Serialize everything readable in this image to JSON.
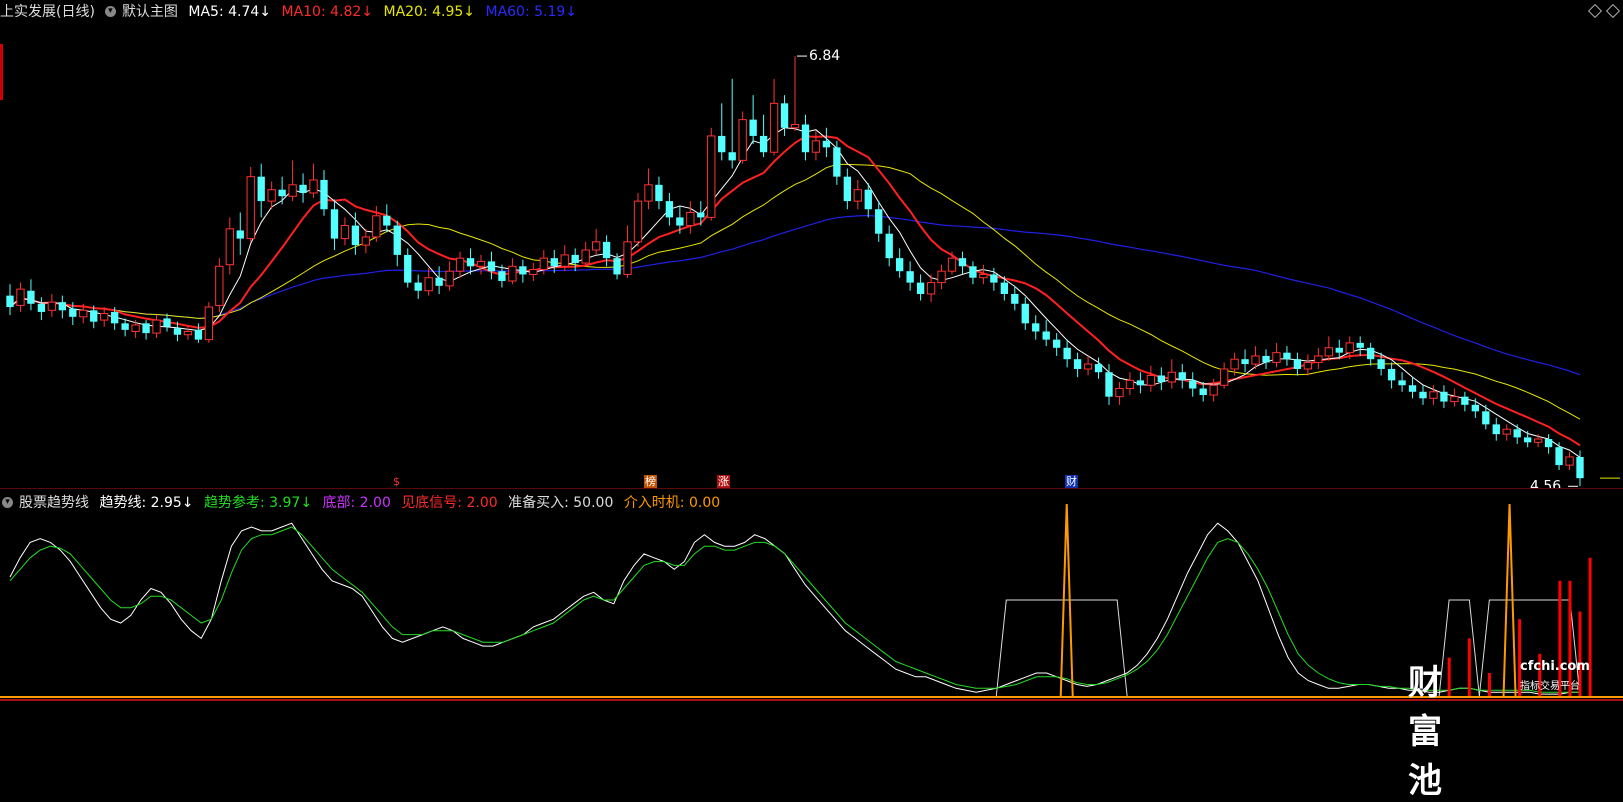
{
  "main_header": {
    "title": "上实发展(日线)",
    "template": "默认主图",
    "ma5": "MA5: 4.74↓",
    "ma10": "MA10: 4.82↓",
    "ma20": "MA20: 4.95↓",
    "ma60": "MA60: 5.19↓"
  },
  "sub_header": {
    "title": "股票趋势线",
    "trend": "趋势线: 2.95↓",
    "trend_ref": "趋势参考: 3.97↓",
    "bottom": "底部: 2.00",
    "bottom_signal": "见底信号: 2.00",
    "prepare_buy": "准备买入: 50.00",
    "entry_timing": "介入时机: 0.00"
  },
  "markers": {
    "s": "$",
    "bang": "榜",
    "zhang": "涨",
    "cai": "财"
  },
  "watermark": {
    "brand": "财富池",
    "url": "cfchi.com",
    "tagline": "指标交易平台"
  },
  "colors": {
    "up": "#ff3232",
    "down": "#54ffff",
    "ma5": "#ffffff",
    "ma10": "#ff2020",
    "ma20": "#e6e600",
    "ma60": "#2020e6",
    "trend": "#ffffff",
    "trend_ref": "#22dd22",
    "signal": "#ff9900",
    "bottom": "#ff0000"
  },
  "chart_data": [
    {
      "type": "candlestick",
      "title": "上实发展(日线)",
      "ylim": [
        4.3,
        7.0
      ],
      "annotations": [
        {
          "label": "6.84",
          "type": "high"
        },
        {
          "label": "4.56",
          "type": "low"
        }
      ],
      "candles": [
        [
          5.37,
          5.3,
          5.44,
          5.25
        ],
        [
          5.31,
          5.41,
          5.45,
          5.27
        ],
        [
          5.4,
          5.32,
          5.47,
          5.28
        ],
        [
          5.32,
          5.27,
          5.36,
          5.22
        ],
        [
          5.28,
          5.33,
          5.38,
          5.24
        ],
        [
          5.33,
          5.28,
          5.37,
          5.23
        ],
        [
          5.29,
          5.24,
          5.33,
          5.19
        ],
        [
          5.24,
          5.28,
          5.32,
          5.2
        ],
        [
          5.28,
          5.21,
          5.31,
          5.17
        ],
        [
          5.22,
          5.26,
          5.3,
          5.18
        ],
        [
          5.27,
          5.2,
          5.3,
          5.16
        ],
        [
          5.2,
          5.16,
          5.23,
          5.12
        ],
        [
          5.15,
          5.19,
          5.22,
          5.11
        ],
        [
          5.2,
          5.14,
          5.22,
          5.1
        ],
        [
          5.14,
          5.22,
          5.25,
          5.11
        ],
        [
          5.23,
          5.18,
          5.26,
          5.15
        ],
        [
          5.17,
          5.13,
          5.21,
          5.09
        ],
        [
          5.13,
          5.15,
          5.18,
          5.1
        ],
        [
          5.16,
          5.1,
          5.2,
          5.08
        ],
        [
          5.1,
          5.3,
          5.33,
          5.08
        ],
        [
          5.31,
          5.55,
          5.6,
          5.27
        ],
        [
          5.56,
          5.78,
          5.85,
          5.5
        ],
        [
          5.77,
          5.72,
          5.88,
          5.62
        ],
        [
          5.72,
          6.1,
          6.16,
          5.7
        ],
        [
          6.1,
          5.95,
          6.18,
          5.85
        ],
        [
          5.95,
          6.02,
          6.07,
          5.9
        ],
        [
          6.02,
          5.98,
          6.1,
          5.93
        ],
        [
          5.98,
          6.05,
          6.2,
          5.95
        ],
        [
          6.05,
          6.0,
          6.12,
          5.94
        ],
        [
          6.0,
          6.08,
          6.18,
          5.97
        ],
        [
          6.08,
          5.9,
          6.14,
          5.86
        ],
        [
          5.9,
          5.72,
          5.96,
          5.65
        ],
        [
          5.72,
          5.8,
          5.85,
          5.68
        ],
        [
          5.8,
          5.68,
          5.88,
          5.62
        ],
        [
          5.68,
          5.73,
          5.78,
          5.63
        ],
        [
          5.73,
          5.86,
          5.92,
          5.7
        ],
        [
          5.86,
          5.8,
          5.93,
          5.76
        ],
        [
          5.8,
          5.62,
          5.83,
          5.55
        ],
        [
          5.62,
          5.45,
          5.66,
          5.42
        ],
        [
          5.45,
          5.4,
          5.5,
          5.35
        ],
        [
          5.4,
          5.48,
          5.54,
          5.37
        ],
        [
          5.48,
          5.43,
          5.55,
          5.38
        ],
        [
          5.43,
          5.52,
          5.58,
          5.4
        ],
        [
          5.52,
          5.6,
          5.64,
          5.48
        ],
        [
          5.6,
          5.55,
          5.66,
          5.5
        ],
        [
          5.55,
          5.58,
          5.62,
          5.5
        ],
        [
          5.58,
          5.52,
          5.64,
          5.47
        ],
        [
          5.52,
          5.46,
          5.56,
          5.42
        ],
        [
          5.46,
          5.55,
          5.6,
          5.44
        ],
        [
          5.55,
          5.5,
          5.59,
          5.45
        ],
        [
          5.5,
          5.53,
          5.57,
          5.46
        ],
        [
          5.53,
          5.6,
          5.65,
          5.5
        ],
        [
          5.6,
          5.55,
          5.65,
          5.51
        ],
        [
          5.55,
          5.62,
          5.68,
          5.52
        ],
        [
          5.62,
          5.57,
          5.66,
          5.52
        ],
        [
          5.57,
          5.65,
          5.7,
          5.55
        ],
        [
          5.65,
          5.7,
          5.78,
          5.62
        ],
        [
          5.7,
          5.6,
          5.74,
          5.55
        ],
        [
          5.6,
          5.5,
          5.63,
          5.47
        ],
        [
          5.5,
          5.7,
          5.8,
          5.48
        ],
        [
          5.7,
          5.95,
          6.0,
          5.67
        ],
        [
          5.95,
          6.05,
          6.15,
          5.9
        ],
        [
          6.05,
          5.95,
          6.1,
          5.9
        ],
        [
          5.95,
          5.85,
          6.0,
          5.8
        ],
        [
          5.85,
          5.8,
          5.92,
          5.75
        ],
        [
          5.8,
          5.88,
          5.95,
          5.75
        ],
        [
          5.88,
          5.85,
          5.95,
          5.8
        ],
        [
          5.85,
          6.35,
          6.4,
          5.83
        ],
        [
          6.35,
          6.25,
          6.55,
          6.2
        ],
        [
          6.25,
          6.2,
          6.7,
          6.15
        ],
        [
          6.2,
          6.45,
          6.5,
          6.18
        ],
        [
          6.45,
          6.35,
          6.6,
          6.3
        ],
        [
          6.35,
          6.25,
          6.48,
          6.22
        ],
        [
          6.25,
          6.55,
          6.7,
          6.23
        ],
        [
          6.55,
          6.4,
          6.6,
          6.35
        ],
        [
          6.4,
          6.42,
          6.84,
          6.38
        ],
        [
          6.42,
          6.25,
          6.48,
          6.2
        ],
        [
          6.25,
          6.32,
          6.38,
          6.2
        ],
        [
          6.32,
          6.28,
          6.4,
          6.22
        ],
        [
          6.28,
          6.1,
          6.32,
          6.05
        ],
        [
          6.1,
          5.95,
          6.15,
          5.9
        ],
        [
          5.95,
          6.02,
          6.08,
          5.9
        ],
        [
          6.02,
          5.9,
          6.06,
          5.85
        ],
        [
          5.9,
          5.75,
          5.95,
          5.7
        ],
        [
          5.75,
          5.6,
          5.8,
          5.55
        ],
        [
          5.6,
          5.52,
          5.66,
          5.48
        ],
        [
          5.52,
          5.45,
          5.58,
          5.4
        ],
        [
          5.45,
          5.38,
          5.5,
          5.34
        ],
        [
          5.38,
          5.45,
          5.5,
          5.33
        ],
        [
          5.45,
          5.52,
          5.56,
          5.41
        ],
        [
          5.52,
          5.6,
          5.64,
          5.5
        ],
        [
          5.6,
          5.55,
          5.64,
          5.5
        ],
        [
          5.55,
          5.48,
          5.58,
          5.44
        ],
        [
          5.48,
          5.5,
          5.56,
          5.44
        ],
        [
          5.5,
          5.45,
          5.54,
          5.4
        ],
        [
          5.45,
          5.38,
          5.49,
          5.34
        ],
        [
          5.38,
          5.32,
          5.43,
          5.28
        ],
        [
          5.32,
          5.2,
          5.36,
          5.16
        ],
        [
          5.2,
          5.15,
          5.25,
          5.1
        ],
        [
          5.15,
          5.1,
          5.22,
          5.06
        ],
        [
          5.1,
          5.05,
          5.14,
          5.0
        ],
        [
          5.05,
          4.98,
          5.1,
          4.93
        ],
        [
          4.98,
          4.92,
          5.02,
          4.87
        ],
        [
          4.92,
          4.95,
          5.0,
          4.88
        ],
        [
          4.95,
          4.9,
          4.99,
          4.86
        ],
        [
          4.9,
          4.75,
          4.95,
          4.7
        ],
        [
          4.75,
          4.8,
          4.84,
          4.7
        ],
        [
          4.8,
          4.85,
          4.9,
          4.76
        ],
        [
          4.85,
          4.82,
          4.9,
          4.77
        ],
        [
          4.82,
          4.88,
          4.94,
          4.78
        ],
        [
          4.88,
          4.84,
          4.93,
          4.79
        ],
        [
          4.84,
          4.9,
          4.98,
          4.8
        ],
        [
          4.9,
          4.85,
          4.95,
          4.8
        ],
        [
          4.85,
          4.8,
          4.9,
          4.75
        ],
        [
          4.8,
          4.76,
          4.84,
          4.72
        ],
        [
          4.76,
          4.82,
          4.86,
          4.72
        ],
        [
          4.82,
          4.92,
          4.96,
          4.8
        ],
        [
          4.92,
          4.98,
          5.02,
          4.88
        ],
        [
          4.98,
          4.95,
          5.04,
          4.9
        ],
        [
          4.95,
          5.0,
          5.06,
          4.92
        ],
        [
          5.0,
          4.96,
          5.04,
          4.92
        ],
        [
          4.96,
          5.02,
          5.08,
          4.93
        ],
        [
          5.02,
          4.98,
          5.06,
          4.94
        ],
        [
          4.98,
          4.92,
          5.02,
          4.88
        ],
        [
          4.92,
          4.96,
          5.01,
          4.88
        ],
        [
          4.96,
          5.0,
          5.05,
          4.92
        ],
        [
          5.0,
          5.05,
          5.12,
          4.97
        ],
        [
          5.05,
          5.02,
          5.1,
          4.98
        ],
        [
          5.02,
          5.08,
          5.12,
          4.98
        ],
        [
          5.08,
          5.05,
          5.12,
          5.0
        ],
        [
          5.05,
          4.98,
          5.08,
          4.94
        ],
        [
          4.98,
          4.92,
          5.02,
          4.88
        ],
        [
          4.92,
          4.85,
          4.96,
          4.8
        ],
        [
          4.85,
          4.82,
          4.9,
          4.78
        ],
        [
          4.82,
          4.78,
          4.87,
          4.74
        ],
        [
          4.78,
          4.74,
          4.82,
          4.7
        ],
        [
          4.74,
          4.78,
          4.82,
          4.7
        ],
        [
          4.78,
          4.72,
          4.82,
          4.68
        ],
        [
          4.72,
          4.75,
          4.8,
          4.69
        ],
        [
          4.75,
          4.7,
          4.78,
          4.66
        ],
        [
          4.7,
          4.66,
          4.74,
          4.62
        ],
        [
          4.66,
          4.58,
          4.7,
          4.55
        ],
        [
          4.58,
          4.52,
          4.62,
          4.48
        ],
        [
          4.52,
          4.55,
          4.58,
          4.48
        ],
        [
          4.55,
          4.5,
          4.58,
          4.46
        ],
        [
          4.5,
          4.47,
          4.54,
          4.44
        ],
        [
          4.47,
          4.49,
          4.52,
          4.44
        ],
        [
          4.49,
          4.44,
          4.52,
          4.4
        ],
        [
          4.44,
          4.33,
          4.47,
          4.3
        ],
        [
          4.33,
          4.38,
          4.41,
          4.3
        ],
        [
          4.38,
          4.25,
          4.42,
          4.2
        ]
      ]
    },
    {
      "type": "line",
      "title": "股票趋势线",
      "ylim": [
        0,
        100
      ],
      "series": [
        {
          "name": "趋势线",
          "values": [
            62,
            72,
            80,
            82,
            80,
            76,
            70,
            62,
            54,
            46,
            40,
            38,
            42,
            50,
            56,
            54,
            48,
            40,
            34,
            30,
            40,
            60,
            78,
            86,
            88,
            86,
            86,
            88,
            90,
            82,
            74,
            66,
            60,
            58,
            56,
            52,
            44,
            36,
            30,
            28,
            30,
            32,
            34,
            36,
            34,
            30,
            28,
            26,
            26,
            28,
            30,
            32,
            36,
            38,
            40,
            44,
            48,
            52,
            54,
            50,
            48,
            60,
            68,
            74,
            72,
            70,
            66,
            70,
            80,
            84,
            80,
            78,
            78,
            80,
            84,
            82,
            78,
            74,
            66,
            58,
            52,
            46,
            40,
            34,
            30,
            26,
            22,
            18,
            14,
            12,
            10,
            10,
            8,
            6,
            4,
            3,
            2,
            3,
            4,
            6,
            8,
            10,
            12,
            12,
            10,
            8,
            6,
            5,
            6,
            8,
            10,
            12,
            16,
            22,
            30,
            40,
            52,
            64,
            74,
            84,
            90,
            86,
            80,
            70,
            60,
            46,
            32,
            20,
            12,
            8,
            6,
            4,
            4,
            5,
            6,
            6,
            5,
            4,
            4,
            3,
            3,
            2,
            2,
            3,
            4,
            4,
            3,
            2,
            2,
            2,
            2,
            2,
            1,
            1,
            1,
            2,
            2
          ]
        },
        {
          "name": "趋势参考",
          "values": [
            60,
            66,
            72,
            76,
            78,
            77,
            74,
            68,
            62,
            56,
            50,
            46,
            46,
            48,
            52,
            52,
            50,
            46,
            42,
            38,
            40,
            50,
            64,
            76,
            82,
            84,
            84,
            86,
            88,
            84,
            78,
            72,
            66,
            62,
            58,
            54,
            48,
            42,
            36,
            32,
            32,
            32,
            34,
            34,
            34,
            32,
            30,
            28,
            28,
            28,
            30,
            32,
            34,
            36,
            38,
            42,
            46,
            50,
            52,
            50,
            50,
            56,
            62,
            68,
            70,
            70,
            68,
            68,
            74,
            78,
            78,
            76,
            76,
            78,
            80,
            80,
            78,
            74,
            68,
            62,
            56,
            50,
            44,
            38,
            34,
            30,
            26,
            22,
            18,
            16,
            14,
            12,
            10,
            8,
            6,
            5,
            4,
            4,
            4,
            5,
            6,
            8,
            10,
            10,
            10,
            9,
            7,
            6,
            6,
            7,
            9,
            11,
            14,
            18,
            24,
            32,
            42,
            52,
            62,
            72,
            80,
            82,
            80,
            74,
            66,
            56,
            44,
            32,
            22,
            16,
            12,
            9,
            7,
            6,
            6,
            6,
            5,
            5,
            4,
            4,
            3,
            3,
            3,
            3,
            4,
            4,
            3,
            3,
            3,
            3,
            3,
            3,
            2,
            2,
            2,
            2,
            2
          ]
        },
        {
          "name": "底部",
          "values": []
        },
        {
          "name": "见底信号",
          "values": []
        },
        {
          "name": "准备买入",
          "values": [
            50
          ]
        },
        {
          "name": "介入时机",
          "values": [
            0
          ]
        }
      ]
    }
  ]
}
